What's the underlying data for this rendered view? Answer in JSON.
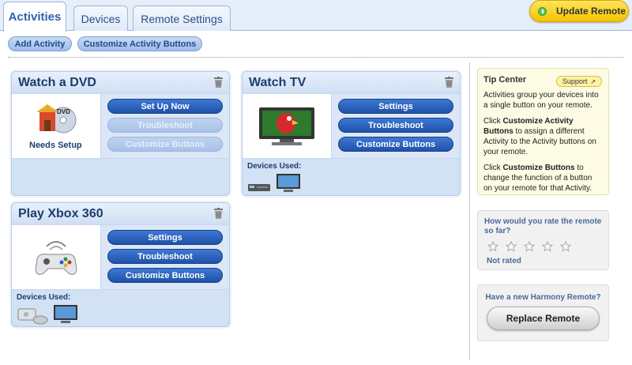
{
  "tabs": [
    {
      "label": "Activities",
      "active": true
    },
    {
      "label": "Devices",
      "active": false
    },
    {
      "label": "Remote Settings",
      "active": false
    }
  ],
  "update_button": {
    "label": "Update Remote"
  },
  "actions": {
    "add_activity": "Add Activity",
    "customize_buttons": "Customize Activity Buttons"
  },
  "activities": [
    {
      "title": "Watch a DVD",
      "status": "Needs Setup",
      "buttons": [
        {
          "label": "Set Up Now",
          "enabled": true
        },
        {
          "label": "Troubleshoot",
          "enabled": false
        },
        {
          "label": "Customize Buttons",
          "enabled": false
        }
      ]
    },
    {
      "title": "Watch TV",
      "buttons": [
        {
          "label": "Settings",
          "enabled": true
        },
        {
          "label": "Troubleshoot",
          "enabled": true
        },
        {
          "label": "Customize Buttons",
          "enabled": true
        }
      ],
      "devices_label": "Devices Used:",
      "devices": [
        "cable-box-icon",
        "tv-icon"
      ]
    },
    {
      "title": "Play Xbox 360",
      "buttons": [
        {
          "label": "Settings",
          "enabled": true
        },
        {
          "label": "Troubleshoot",
          "enabled": true
        },
        {
          "label": "Customize Buttons",
          "enabled": true
        }
      ],
      "devices_label": "Devices Used:",
      "devices": [
        "console-icon",
        "tv-icon"
      ]
    }
  ],
  "tip_center": {
    "title": "Tip Center",
    "support_label": "Support",
    "p1": "Activities group your devices into a single button on your remote.",
    "p2_pre": "Click ",
    "p2_bold": "Customize Activity Buttons",
    "p2_post": " to assign a different Activity to the Activity buttons on your remote.",
    "p3_pre": "Click ",
    "p3_bold": "Customize Buttons",
    "p3_post": " to change the function of a button on your remote for that Activity."
  },
  "rating": {
    "question": "How would you rate the remote so far?",
    "stars": 5,
    "status": "Not rated"
  },
  "replace": {
    "question": "Have a new Harmony Remote?",
    "button_label": "Replace Remote"
  },
  "colors": {
    "accent_blue": "#1f52a8",
    "update_yellow": "#f5c400",
    "card_bg": "#d2e1f4"
  }
}
